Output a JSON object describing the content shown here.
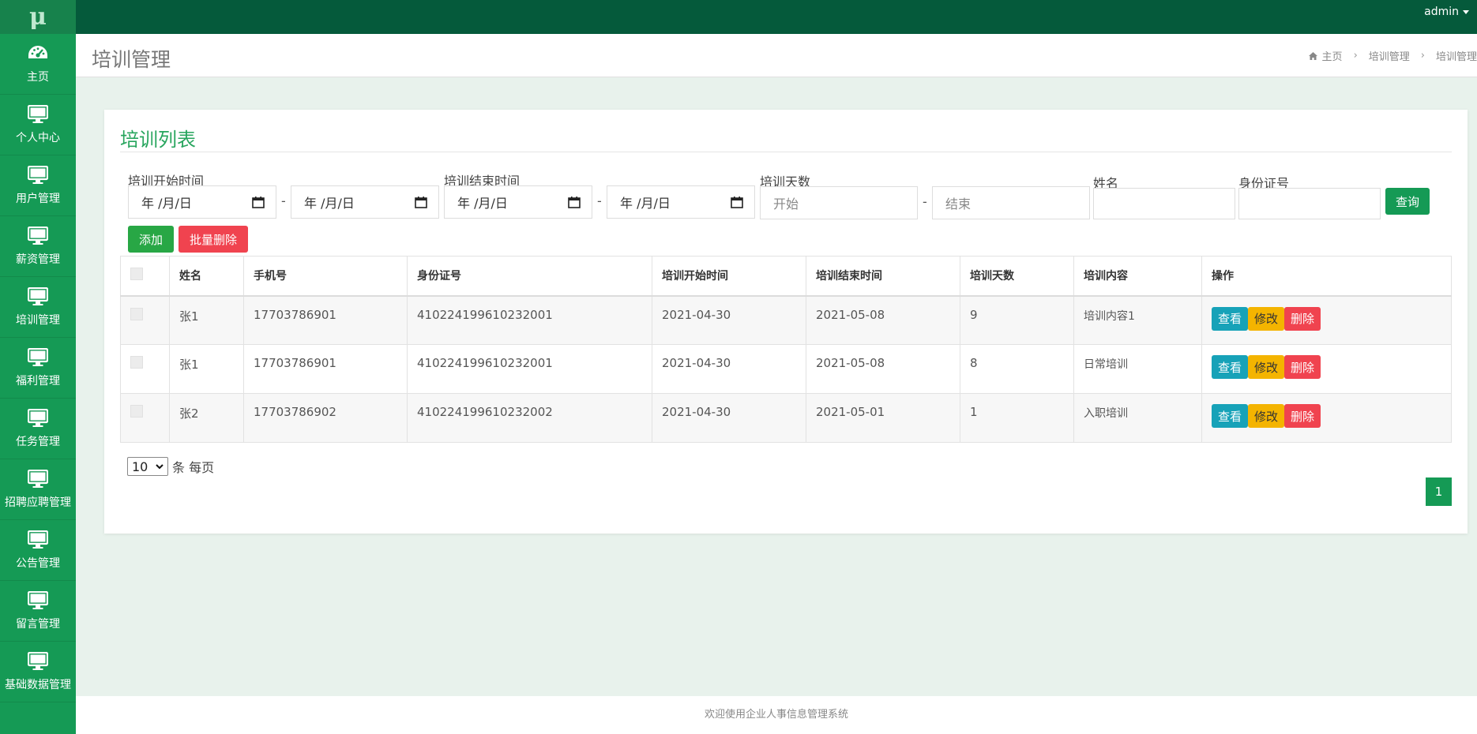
{
  "app": {
    "logo": "μ"
  },
  "topbar": {
    "user": "admin"
  },
  "sidebar": {
    "items": [
      {
        "label": "主页",
        "icon": "dashboard-icon"
      },
      {
        "label": "个人中心",
        "icon": "monitor-icon"
      },
      {
        "label": "用户管理",
        "icon": "monitor-icon"
      },
      {
        "label": "薪资管理",
        "icon": "monitor-icon"
      },
      {
        "label": "培训管理",
        "icon": "monitor-icon"
      },
      {
        "label": "福利管理",
        "icon": "monitor-icon"
      },
      {
        "label": "任务管理",
        "icon": "monitor-icon"
      },
      {
        "label": "招聘应聘管理",
        "icon": "monitor-icon"
      },
      {
        "label": "公告管理",
        "icon": "monitor-icon"
      },
      {
        "label": "留言管理",
        "icon": "monitor-icon"
      },
      {
        "label": "基础数据管理",
        "icon": "monitor-icon"
      }
    ]
  },
  "header": {
    "title": "培训管理",
    "breadcrumb": [
      "主页",
      "培训管理",
      "培训管理"
    ]
  },
  "card": {
    "title": "培训列表"
  },
  "filters": {
    "start_label": "培训开始时间",
    "end_label": "培训结束时间",
    "days_label": "培训天数",
    "name_label": "姓名",
    "id_label": "身份证号",
    "date_placeholder": "年 /月/日",
    "days_from_placeholder": "开始",
    "days_to_placeholder": "结束",
    "dash": "-",
    "query_button": "查询"
  },
  "actions": {
    "add": "添加",
    "bulk_delete": "批量删除"
  },
  "table": {
    "columns": [
      "姓名",
      "手机号",
      "身份证号",
      "培训开始时间",
      "培训结束时间",
      "培训天数",
      "培训内容",
      "操作"
    ],
    "rows": [
      {
        "name": "张1",
        "phone": "17703786901",
        "id_no": "410224199610232001",
        "start": "2021-04-30",
        "end": "2021-05-08",
        "days": "9",
        "content": "培训内容1"
      },
      {
        "name": "张1",
        "phone": "17703786901",
        "id_no": "410224199610232001",
        "start": "2021-04-30",
        "end": "2021-05-08",
        "days": "8",
        "content": "日常培训"
      },
      {
        "name": "张2",
        "phone": "17703786902",
        "id_no": "410224199610232002",
        "start": "2021-04-30",
        "end": "2021-05-01",
        "days": "1",
        "content": "入职培训"
      }
    ],
    "op_view": "查看",
    "op_edit": "修改",
    "op_delete": "删除"
  },
  "pagination": {
    "page_size": "10",
    "per_page_text": "条 每页",
    "current_page": "1"
  },
  "footer": {
    "text": "欢迎使用企业人事信息管理系统"
  },
  "colors": {
    "sidebar": "#159a55",
    "topbar": "#055a3b",
    "accent": "#27a55d",
    "danger": "#f0434f",
    "info": "#17a2b8",
    "warning": "#f4b400"
  }
}
